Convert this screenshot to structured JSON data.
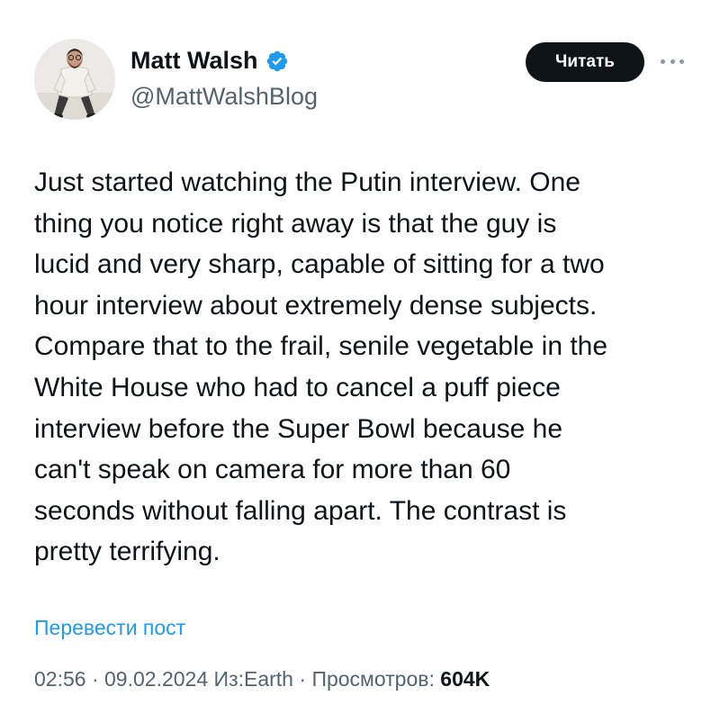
{
  "author": {
    "display_name": "Matt Walsh",
    "handle": "@MattWalshBlog",
    "verified": true
  },
  "follow_button": {
    "label": "Читать"
  },
  "more_menu": {
    "icon": "more-horizontal-icon"
  },
  "tweet": {
    "text": "Just started watching the Putin interview. One\nthing you notice right away is that the guy is\nlucid and very sharp, capable of sitting for a two\nhour interview about extremely dense subjects.\nCompare that to the frail, senile vegetable in the\nWhite House who had to cancel a puff piece\ninterview before the Super Bowl because he\ncan't speak on camera for more than 60\nseconds without falling apart. The contrast is\npretty terrifying."
  },
  "translate_link": {
    "label": "Перевести пост"
  },
  "meta": {
    "time": "02:56",
    "date": "09.02.2024",
    "location": "Из:Earth",
    "views_label": "Просмотров:",
    "views_count": "604K",
    "separator": "·"
  },
  "colors": {
    "text_primary": "#0f1419",
    "text_secondary": "#536471",
    "link": "#1d9bf0",
    "verified": "#1d9bf0",
    "button_bg": "#0f1419"
  }
}
